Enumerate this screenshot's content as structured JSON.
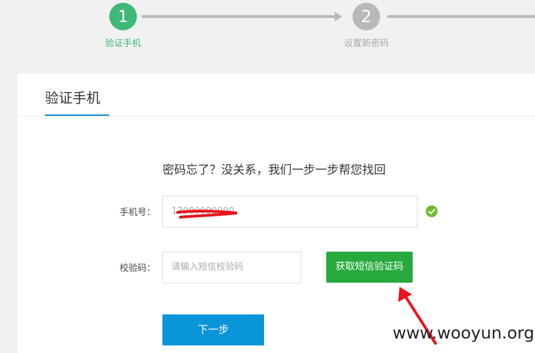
{
  "steps": [
    {
      "number": "1",
      "label": "验证手机",
      "state": "active"
    },
    {
      "number": "2",
      "label": "设置新密码",
      "state": "inactive"
    }
  ],
  "card": {
    "title": "验证手机",
    "slogan": "密码忘了？没关系，我们一步一步帮您找回"
  },
  "form": {
    "phone_label": "手机号：",
    "phone_value": "13000000000",
    "code_label": "校验码：",
    "code_placeholder": "请输入短信校验码",
    "sms_button": "获取短信验证码",
    "next_button": "下一步"
  },
  "icons": {
    "phone_valid": "check-circle-icon",
    "annotation": "red-arrow-icon"
  },
  "watermark": "www.wooyun.org",
  "colors": {
    "active_step": "#3db877",
    "inactive_step": "#b9b9b9",
    "accent": "#0a8ad5",
    "sms_button": "#27a93e",
    "next_button": "#0b95d9",
    "valid": "#6fba2c"
  }
}
